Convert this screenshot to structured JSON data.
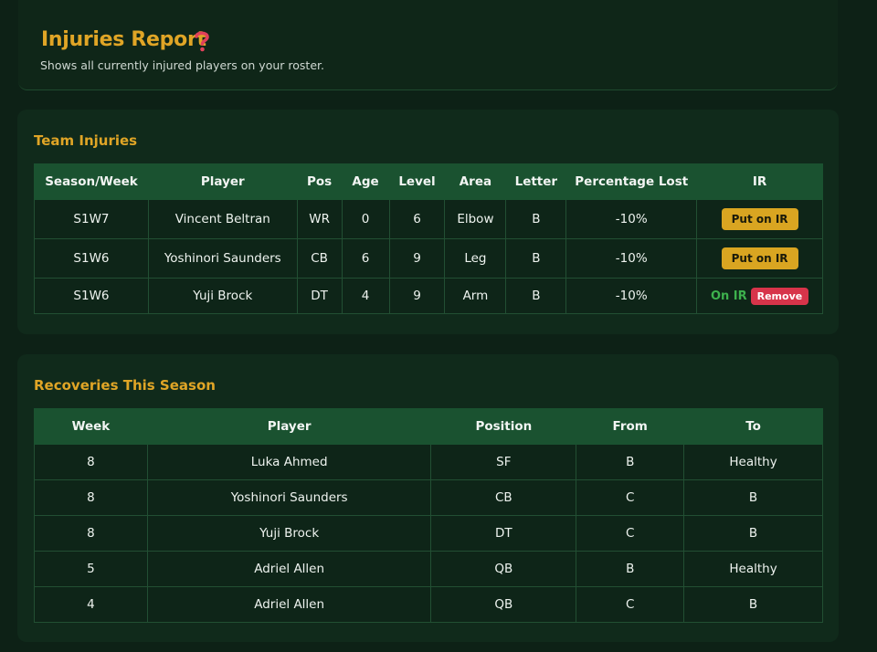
{
  "header": {
    "title": "Injuries Report",
    "subtitle": "Shows all currently injured players on your roster."
  },
  "team_injuries": {
    "title": "Team Injuries",
    "columns": [
      "Season/Week",
      "Player",
      "Pos",
      "Age",
      "Level",
      "Area",
      "Letter",
      "Percentage Lost",
      "IR"
    ],
    "rows": [
      {
        "season_week": "S1W7",
        "player": "Vincent Beltran",
        "pos": "WR",
        "age": "0",
        "level": "6",
        "area": "Elbow",
        "letter": "B",
        "pct_lost": "-10%",
        "ir_action": "Put on IR"
      },
      {
        "season_week": "S1W6",
        "player": "Yoshinori Saunders",
        "pos": "CB",
        "age": "6",
        "level": "9",
        "area": "Leg",
        "letter": "B",
        "pct_lost": "-10%",
        "ir_action": "Put on IR"
      },
      {
        "season_week": "S1W6",
        "player": "Yuji Brock",
        "pos": "DT",
        "age": "4",
        "level": "9",
        "area": "Arm",
        "letter": "B",
        "pct_lost": "-10%",
        "ir_status": "On IR",
        "ir_action": "Remove"
      }
    ]
  },
  "recoveries": {
    "title": "Recoveries This Season",
    "columns": [
      "Week",
      "Player",
      "Position",
      "From",
      "To"
    ],
    "rows": [
      {
        "week": "8",
        "player": "Luka Ahmed",
        "position": "SF",
        "from": "B",
        "to": "Healthy"
      },
      {
        "week": "8",
        "player": "Yoshinori Saunders",
        "position": "CB",
        "from": "C",
        "to": "B"
      },
      {
        "week": "8",
        "player": "Yuji Brock",
        "position": "DT",
        "from": "C",
        "to": "B"
      },
      {
        "week": "5",
        "player": "Adriel Allen",
        "position": "QB",
        "from": "B",
        "to": "Healthy"
      },
      {
        "week": "4",
        "player": "Adriel Allen",
        "position": "QB",
        "from": "C",
        "to": "B"
      }
    ]
  },
  "icons": {
    "help": "question-mark-icon"
  },
  "colors": {
    "accent": "#e0a526",
    "header_row": "#1a5230",
    "on_ir": "#3db14d",
    "remove": "#d7344a",
    "put_on_ir": "#d9a521"
  }
}
